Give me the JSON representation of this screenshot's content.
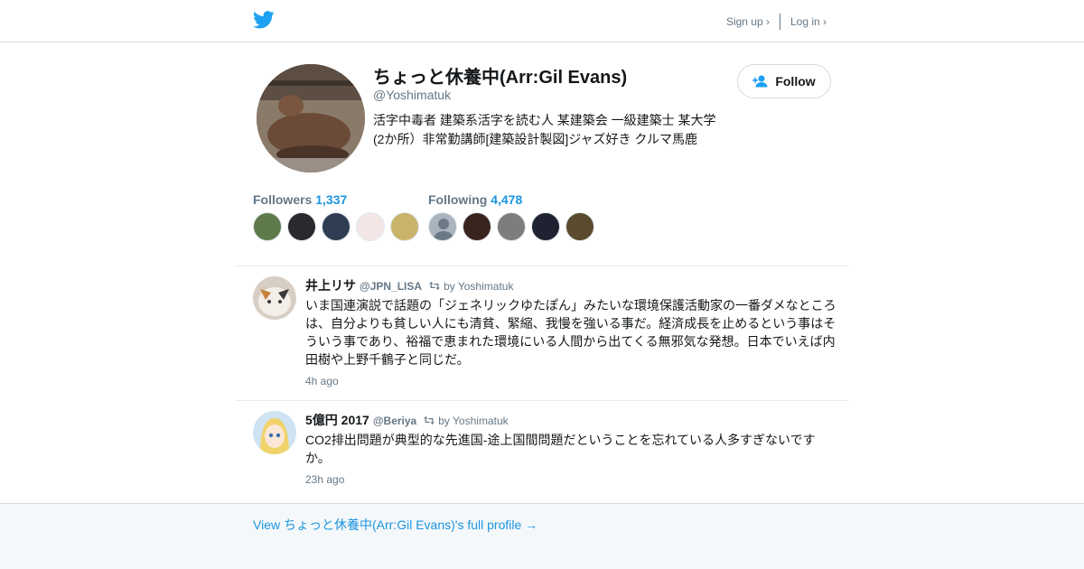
{
  "header": {
    "signup_label": "Sign up ›",
    "login_label": "Log in ›",
    "brand_color": "#1da1f2"
  },
  "profile": {
    "name": "ちょっと休養中(Arr:Gil Evans)",
    "handle": "@Yoshimatuk",
    "bio_line1": "活字中毒者 建築系活字を読む人 某建築会 一級建築士 某大学",
    "bio_line2": "(2か所）非常勤講師[建築設計製図]ジャズ好き クルマ馬鹿",
    "follow_label": "Follow"
  },
  "stats": {
    "followers_label": "Followers",
    "followers_count": "1,337",
    "following_label": "Following",
    "following_count": "4,478"
  },
  "tweets": [
    {
      "name": "井上リサ",
      "handle": "@JPN_LISA",
      "retweet_by": "by Yoshimatuk",
      "text": "いま国連演説で話題の「ジェネリックゆたぽん」みたいな環境保護活動家の一番ダメなところは、自分よりも貧しい人にも清貧、緊縮、我慢を強いる事だ。経済成長を止めるという事はそういう事であり、裕福で恵まれた環境にいる人間から出てくる無邪気な発想。日本でいえば内田樹や上野千鶴子と同じだ。",
      "time": "4h ago"
    },
    {
      "name": "5億円 2017",
      "handle": "@Beriya",
      "retweet_by": "by Yoshimatuk",
      "text": "CO2排出問題が典型的な先進国-途上国間問題だということを忘れている人多すぎないですか。",
      "time": "23h ago"
    }
  ],
  "footer": {
    "link_label": "View ちょっと休養中(Arr:Gil Evans)'s full profile →"
  }
}
